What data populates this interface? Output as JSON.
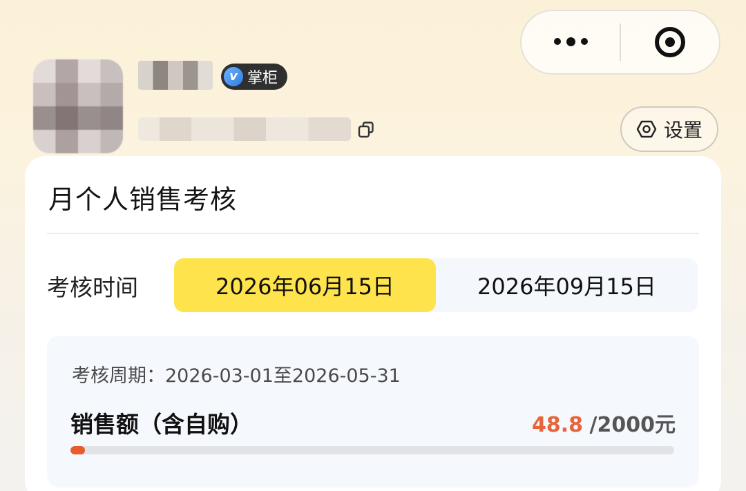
{
  "capsule": {
    "more_icon": "more-dots-icon",
    "close_icon": "target-close-icon"
  },
  "profile": {
    "badge_label": "掌柜",
    "badge_icon": "verified-v-icon"
  },
  "settings": {
    "label": "设置",
    "icon": "hexagon-gear-icon"
  },
  "card": {
    "title": "月个人销售考核",
    "period_label": "考核时间",
    "periods": [
      {
        "label": "2026年06月15日",
        "active": true
      },
      {
        "label": "2026年09月15日",
        "active": false
      }
    ],
    "cycle_text": "考核周期：2026-03-01至2026-05-31",
    "metric": {
      "label": "销售额（含自购）",
      "current": "48.8",
      "target": "/2000元",
      "progress_fraction": 0.0244
    }
  },
  "colors": {
    "accent_yellow": "#ffe34d",
    "progress_orange": "#ea5a2a",
    "value_orange": "#e8643a"
  }
}
